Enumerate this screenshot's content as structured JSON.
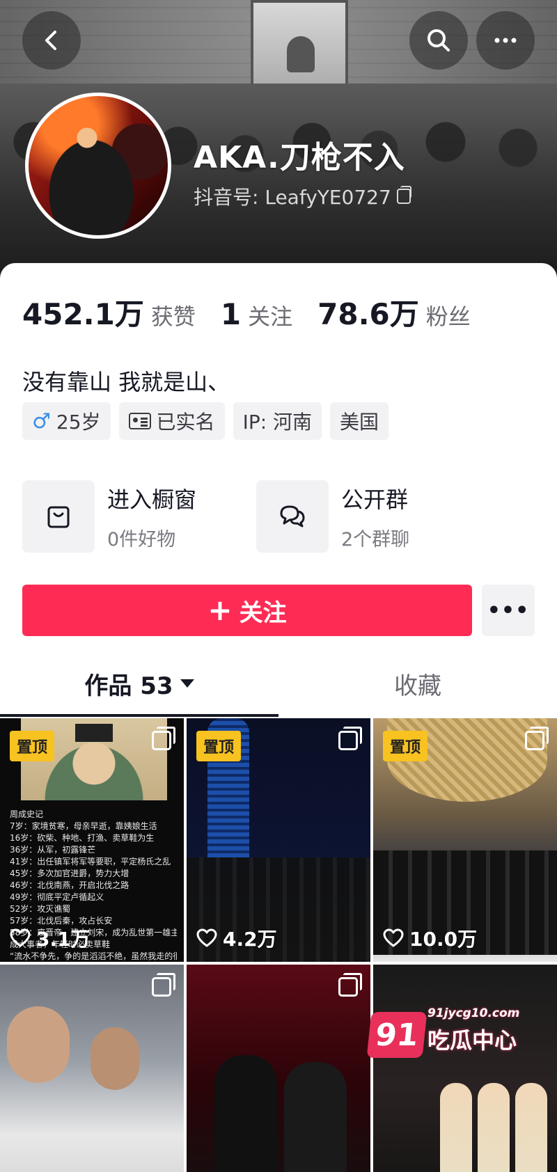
{
  "header": {
    "username": "AKA.刀枪不入",
    "account_id": "抖音号: LeafyYE0727"
  },
  "stats": [
    {
      "value": "452.1万",
      "label": "获赞"
    },
    {
      "value": "1",
      "label": "关注"
    },
    {
      "value": "78.6万",
      "label": "粉丝"
    }
  ],
  "bio": "没有靠山 我就是山、",
  "tags": {
    "gender_icon": "♂",
    "age": "25岁",
    "verified": "已实名",
    "ip": "IP: 河南",
    "location": "美国"
  },
  "entries": {
    "shop": {
      "title": "进入橱窗",
      "subtitle": "0件好物",
      "icon": "shopping-bag-icon"
    },
    "group": {
      "title": "公开群",
      "subtitle": "2个群聊",
      "icon": "chat-bubbles-icon"
    }
  },
  "actions": {
    "follow_plus": "+",
    "follow_label": "关注",
    "more": "•••"
  },
  "tabs": {
    "works": "作品 53",
    "favorites": "收藏"
  },
  "videos": [
    {
      "pinned": "置顶",
      "likes": "3.1万",
      "text_lines": [
        "周成史记",
        "7岁：家境贫寒，母亲早逝，靠姨娘生活",
        "16岁：砍柴、种地、打渔、卖草鞋为生",
        "36岁：从军，初露锋芒",
        "41岁：出任镇军将军等要职，平定杨氏之乱",
        "45岁：多次加官进爵，势力大增",
        "46岁：北伐南燕，开启北伐之路",
        "49岁：彻底平定卢循起义",
        "52岁：攻灭谯蜀",
        "57岁：北伐后秦，攻占长安",
        "58岁：废晋帝，建立刘宋，成为乱世第一雄主",
        "成大事者，年轻时必卖草鞋",
        "“流水不争先，争的是滔滔不绝，虽然我走的很"
      ]
    },
    {
      "pinned": "置顶",
      "likes": "4.2万"
    },
    {
      "pinned": "置顶",
      "likes": "10.0万"
    },
    {},
    {},
    {}
  ],
  "watermark": {
    "logo": "91",
    "site": "91jycg10.com",
    "name": "吃瓜中心"
  },
  "colors": {
    "accent": "#fe2c55",
    "pin": "#f8c220",
    "male": "#3a8ee6"
  }
}
